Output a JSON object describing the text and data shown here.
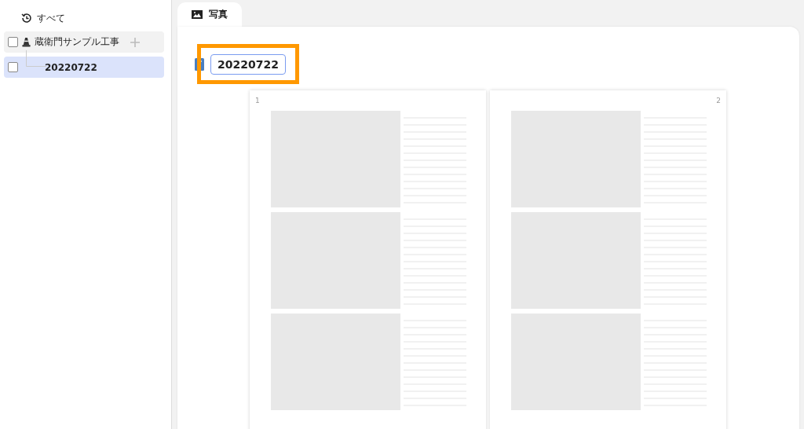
{
  "sidebar": {
    "all_label": "すべて",
    "tree": [
      {
        "label": "蔵衛門サンプル工事",
        "checked": false,
        "selected": false,
        "children": [
          {
            "label": "20220722",
            "checked": false,
            "selected": true
          }
        ]
      }
    ]
  },
  "tabs": [
    {
      "label": "写真",
      "selected": true
    }
  ],
  "album": {
    "title": "20220722",
    "highlighted": true
  },
  "pages": [
    {
      "number": "1",
      "slots": [
        {
          "kind": "placeholder"
        },
        {
          "kind": "placeholder"
        },
        {
          "kind": "placeholder"
        }
      ]
    },
    {
      "number": "2",
      "slots": [
        {
          "kind": "placeholder"
        },
        {
          "kind": "placeholder"
        },
        {
          "kind": "placeholder"
        }
      ]
    }
  ]
}
